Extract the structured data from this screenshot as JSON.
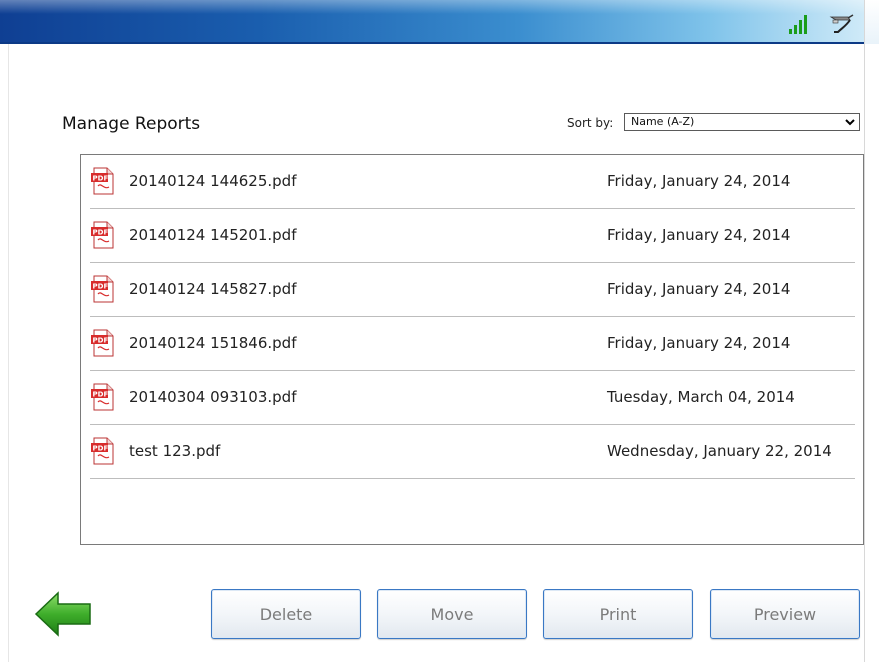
{
  "header": {
    "icons": [
      "signal-strength-icon",
      "network-cable-icon"
    ],
    "colors": {
      "bar_start": "#0f3f93",
      "bar_end": "#cfeaf8",
      "signal": "#1a9d1a"
    }
  },
  "page": {
    "title": "Manage Reports"
  },
  "sort": {
    "label": "Sort by:",
    "selected": "Name (A-Z)"
  },
  "files": [
    {
      "name": "20140124 144625.pdf",
      "date": "Friday, January 24, 2014",
      "icon": "pdf-file-icon"
    },
    {
      "name": "20140124 145201.pdf",
      "date": "Friday, January 24, 2014",
      "icon": "pdf-file-icon"
    },
    {
      "name": "20140124 145827.pdf",
      "date": "Friday, January 24, 2014",
      "icon": "pdf-file-icon"
    },
    {
      "name": "20140124 151846.pdf",
      "date": "Friday, January 24, 2014",
      "icon": "pdf-file-icon"
    },
    {
      "name": "20140304 093103.pdf",
      "date": "Tuesday, March 04, 2014",
      "icon": "pdf-file-icon"
    },
    {
      "name": "test 123.pdf",
      "date": "Wednesday, January 22, 2014",
      "icon": "pdf-file-icon"
    }
  ],
  "actions": {
    "back_icon": "back-arrow-icon",
    "delete": "Delete",
    "move": "Move",
    "print": "Print",
    "preview": "Preview"
  }
}
